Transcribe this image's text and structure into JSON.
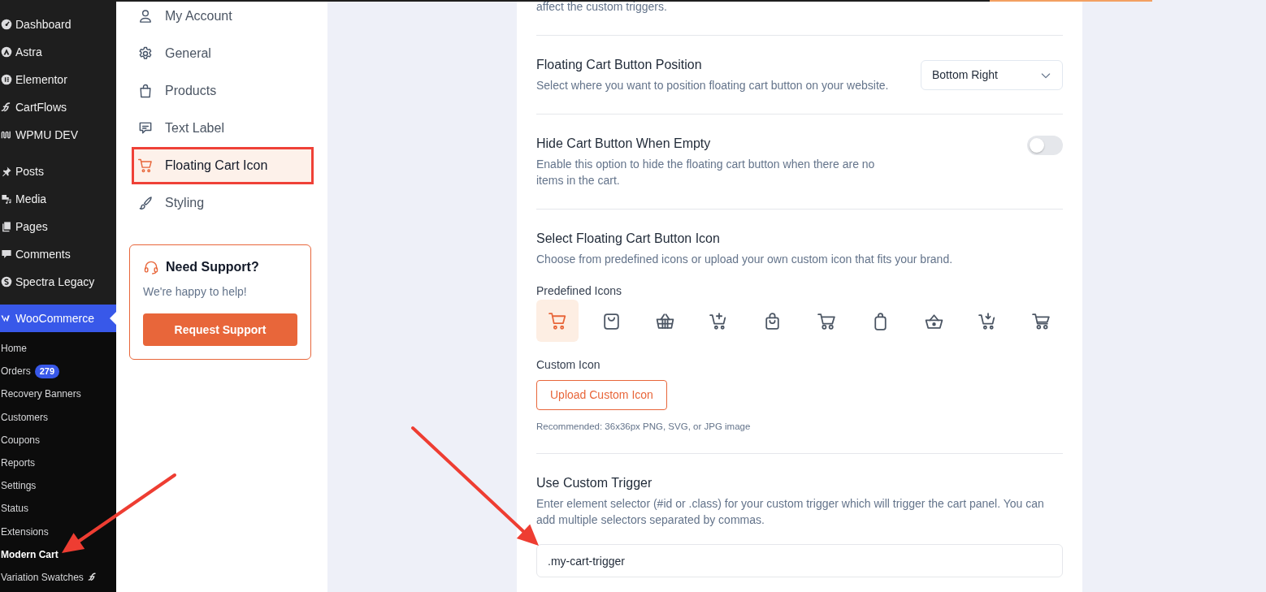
{
  "admin_menu": {
    "groups": [
      {
        "items": [
          {
            "label": "Dashboard",
            "kind": "gauge",
            "selected": false
          },
          {
            "label": "Astra",
            "kind": "triangle",
            "selected": false
          },
          {
            "label": "Elementor",
            "kind": "bars",
            "selected": false
          },
          {
            "label": "CartFlows",
            "kind": "flourish",
            "selected": false
          },
          {
            "label": "WPMU DEV",
            "kind": "wave",
            "selected": false
          }
        ]
      },
      {
        "items": [
          {
            "label": "Posts",
            "kind": "pin",
            "selected": false
          },
          {
            "label": "Media",
            "kind": "media",
            "selected": false
          },
          {
            "label": "Pages",
            "kind": "pages",
            "selected": false
          },
          {
            "label": "Comments",
            "kind": "bubble",
            "selected": false
          },
          {
            "label": "Spectra Legacy",
            "kind": "swirl",
            "selected": false
          }
        ]
      },
      {
        "items": [
          {
            "label": "WooCommerce",
            "kind": "zigzag",
            "selected": true,
            "children": [
              {
                "label": "Home",
                "kind": "text",
                "selected": false
              },
              {
                "label": "Orders",
                "kind": "text",
                "badge": "279",
                "selected": false
              },
              {
                "label": "Recovery Banners",
                "kind": "text",
                "selected": false
              },
              {
                "label": "Customers",
                "kind": "text",
                "selected": false
              },
              {
                "label": "Coupons",
                "kind": "text",
                "selected": false
              },
              {
                "label": "Reports",
                "kind": "text",
                "selected": false
              },
              {
                "label": "Settings",
                "kind": "text",
                "selected": false
              },
              {
                "label": "Status",
                "kind": "text",
                "selected": false
              },
              {
                "label": "Extensions",
                "kind": "text",
                "selected": false
              },
              {
                "label": "Modern Cart",
                "kind": "text",
                "selected": true
              },
              {
                "label": "Variation Swatches",
                "kind": "logo",
                "selected": false
              }
            ]
          }
        ]
      }
    ]
  },
  "settings_nav": {
    "items": [
      {
        "label": "My Account",
        "kind": "user",
        "selected": false,
        "annotated": false
      },
      {
        "label": "General",
        "kind": "gear",
        "selected": false,
        "annotated": false
      },
      {
        "label": "Products",
        "kind": "bag",
        "selected": false,
        "annotated": false
      },
      {
        "label": "Text Label",
        "kind": "message",
        "selected": false,
        "annotated": false
      },
      {
        "label": "Floating Cart Icon",
        "kind": "cart",
        "selected": true,
        "annotated": true
      },
      {
        "label": "Styling",
        "kind": "brush",
        "selected": false,
        "annotated": false
      }
    ],
    "support": {
      "title": "Need Support?",
      "text": "We're happy to help!",
      "button": "Request Support"
    }
  },
  "settings_panel": {
    "intro_tail": "affect the custom triggers.",
    "sections": [
      {
        "kind": "select",
        "title": "Floating Cart Button Position",
        "description": "Select where you want to position floating cart button on your website.",
        "value": "Bottom Right"
      },
      {
        "kind": "toggle",
        "title": "Hide Cart Button When Empty",
        "description": "Enable this option to hide the floating cart button when there are no items in the cart.",
        "on": false
      },
      {
        "kind": "icon_picker",
        "title": "Select Floating Cart Button Icon",
        "description": "Choose from predefined icons or upload your own custom icon that fits your brand.",
        "predefined_label": "Predefined Icons",
        "icons": [
          {
            "kind": "cart",
            "selected": true
          },
          {
            "kind": "boxbag",
            "selected": false
          },
          {
            "kind": "basket",
            "selected": false
          },
          {
            "kind": "cartplus",
            "selected": false
          },
          {
            "kind": "handbag",
            "selected": false
          },
          {
            "kind": "trolley",
            "selected": false
          },
          {
            "kind": "tote",
            "selected": false
          },
          {
            "kind": "hamper",
            "selected": false
          },
          {
            "kind": "cartarrow",
            "selected": false
          },
          {
            "kind": "wagon",
            "selected": false
          }
        ],
        "custom_label": "Custom Icon",
        "upload_button": "Upload Custom Icon",
        "hint": "Recommended: 36x36px PNG, SVG, or JPG image"
      },
      {
        "kind": "text_input",
        "title": "Use Custom Trigger",
        "description": "Enter element selector (#id or .class) for your custom trigger which will trigger the cart panel. You can add multiple selectors separated by commas.",
        "value": ".my-cart-trigger"
      }
    ]
  }
}
